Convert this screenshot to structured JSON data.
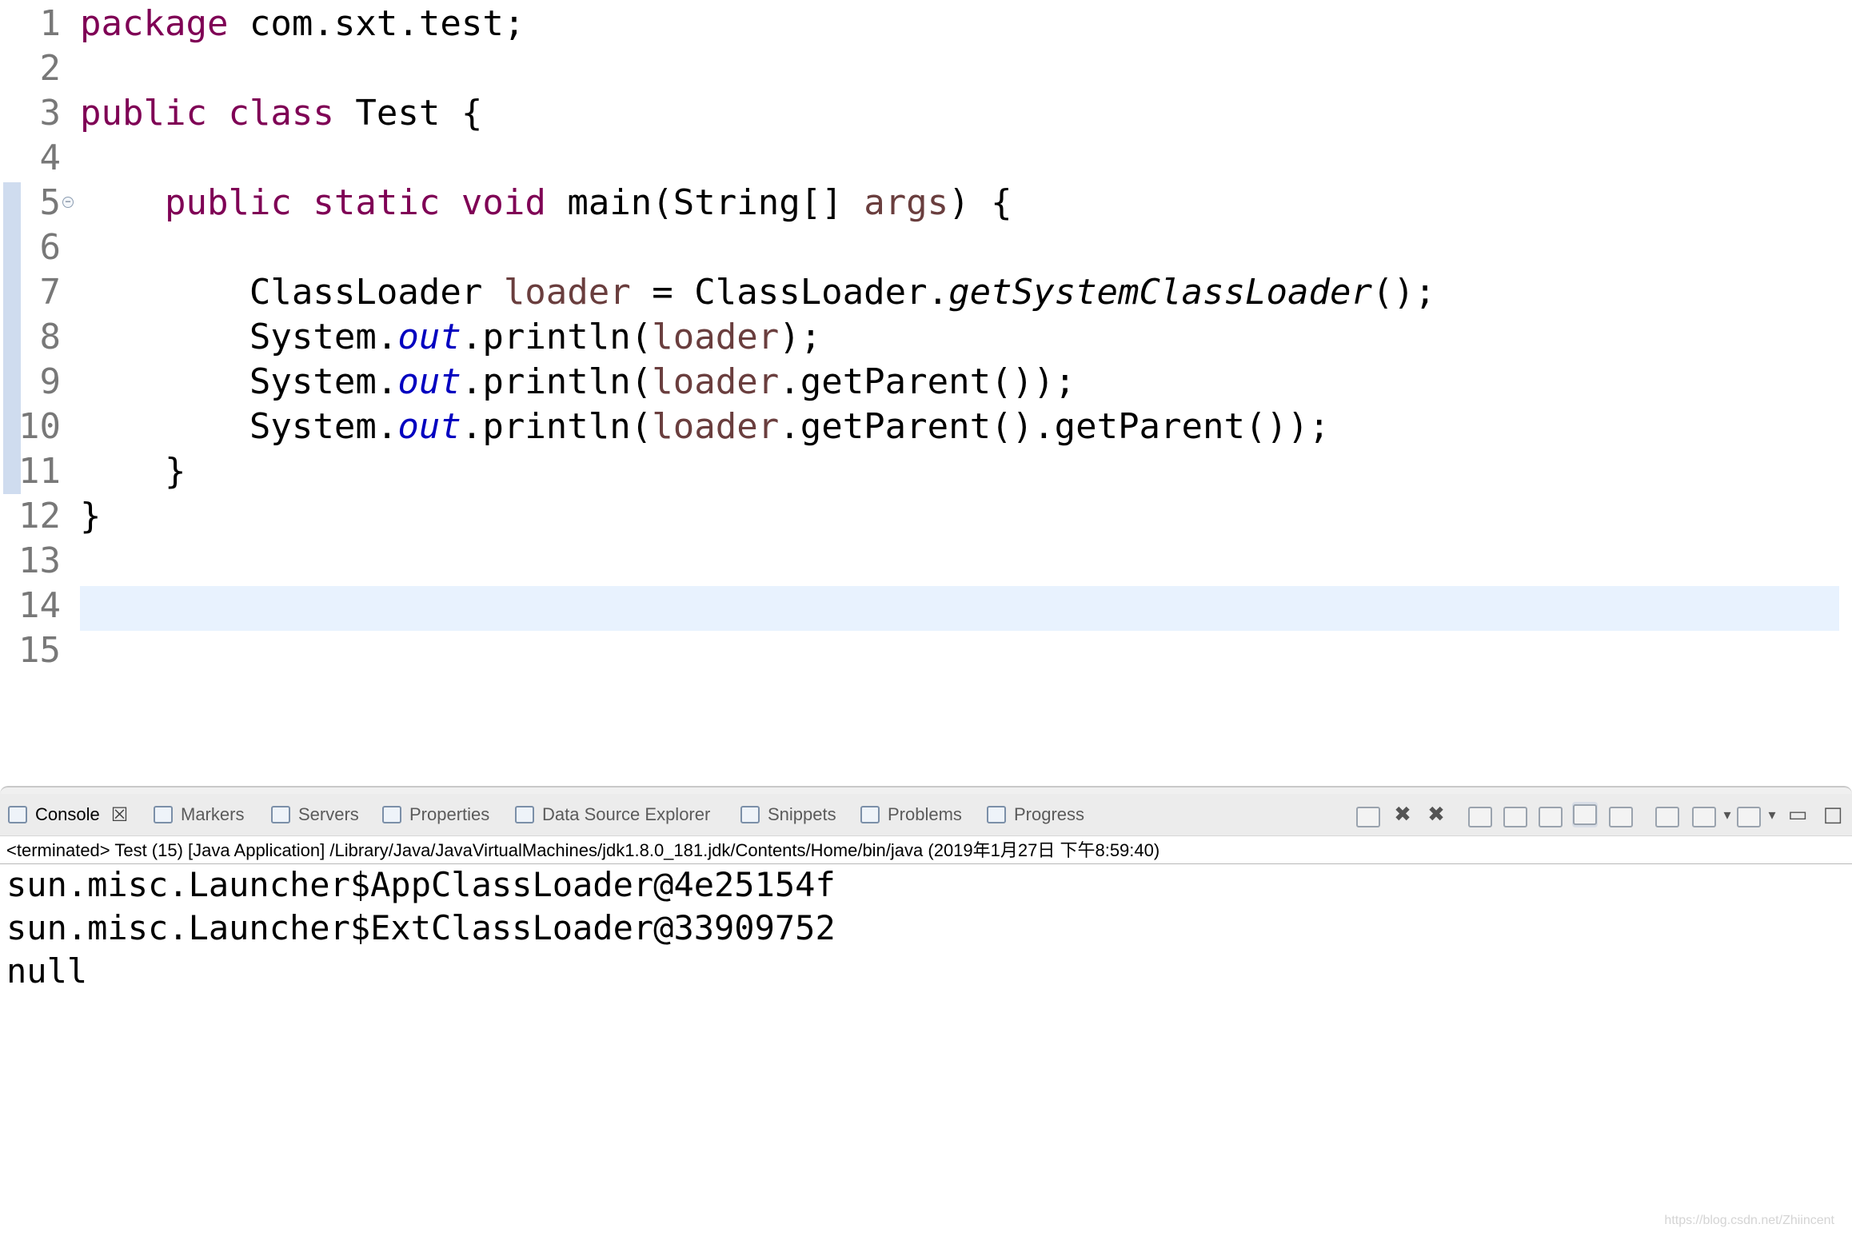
{
  "editor": {
    "lines": [
      {
        "num": "1",
        "parts": [
          {
            "t": "package",
            "c": "kw"
          },
          {
            "t": " com.sxt.test;"
          }
        ]
      },
      {
        "num": "2",
        "parts": []
      },
      {
        "num": "3",
        "parts": [
          {
            "t": "public",
            "c": "kw"
          },
          {
            "t": " "
          },
          {
            "t": "class",
            "c": "kw"
          },
          {
            "t": " Test {"
          }
        ]
      },
      {
        "num": "4",
        "parts": []
      },
      {
        "num": "5",
        "fold": true,
        "parts": [
          {
            "t": "    "
          },
          {
            "t": "public",
            "c": "kw"
          },
          {
            "t": " "
          },
          {
            "t": "static",
            "c": "kw"
          },
          {
            "t": " "
          },
          {
            "t": "void",
            "c": "kw"
          },
          {
            "t": " main(String[] "
          },
          {
            "t": "args",
            "c": "var"
          },
          {
            "t": ") {"
          }
        ]
      },
      {
        "num": "6",
        "parts": []
      },
      {
        "num": "7",
        "parts": [
          {
            "t": "        ClassLoader "
          },
          {
            "t": "loader",
            "c": "var"
          },
          {
            "t": " = ClassLoader."
          },
          {
            "t": "getSystemClassLoader",
            "c": "smeth"
          },
          {
            "t": "();"
          }
        ]
      },
      {
        "num": "8",
        "parts": [
          {
            "t": "        System."
          },
          {
            "t": "out",
            "c": "fld"
          },
          {
            "t": ".println("
          },
          {
            "t": "loader",
            "c": "var"
          },
          {
            "t": ");"
          }
        ]
      },
      {
        "num": "9",
        "parts": [
          {
            "t": "        System."
          },
          {
            "t": "out",
            "c": "fld"
          },
          {
            "t": ".println("
          },
          {
            "t": "loader",
            "c": "var"
          },
          {
            "t": ".getParent());"
          }
        ]
      },
      {
        "num": "10",
        "parts": [
          {
            "t": "        System."
          },
          {
            "t": "out",
            "c": "fld"
          },
          {
            "t": ".println("
          },
          {
            "t": "loader",
            "c": "var"
          },
          {
            "t": ".getParent().getParent());"
          }
        ]
      },
      {
        "num": "11",
        "parts": [
          {
            "t": "    }"
          }
        ]
      },
      {
        "num": "12",
        "parts": [
          {
            "t": "}"
          }
        ]
      },
      {
        "num": "13",
        "parts": []
      },
      {
        "num": "14",
        "parts": []
      },
      {
        "num": "15",
        "parts": []
      }
    ],
    "fold_glyph": "⊖"
  },
  "tabs": [
    {
      "id": "console",
      "label": "Console",
      "active": true,
      "icon": "console-icon"
    },
    {
      "id": "markers",
      "label": "Markers",
      "icon": "markers-icon"
    },
    {
      "id": "servers",
      "label": "Servers",
      "icon": "servers-icon"
    },
    {
      "id": "properties",
      "label": "Properties",
      "icon": "properties-icon"
    },
    {
      "id": "data-source-explorer",
      "label": "Data Source Explorer",
      "icon": "data-source-explorer-icon"
    },
    {
      "id": "snippets",
      "label": "Snippets",
      "icon": "snippets-icon"
    },
    {
      "id": "problems",
      "label": "Problems",
      "icon": "problems-icon"
    },
    {
      "id": "progress",
      "label": "Progress",
      "icon": "progress-icon"
    }
  ],
  "tab_close_glyph": "☒",
  "toolbar_glyphs": {
    "remove_launch": "✖",
    "remove_all": "✖",
    "minimize": "▭",
    "maximize": "□",
    "dropdown": "▾"
  },
  "console": {
    "header": "<terminated> Test (15) [Java Application] /Library/Java/JavaVirtualMachines/jdk1.8.0_181.jdk/Contents/Home/bin/java (2019年1月27日 下午8:59:40)",
    "output": [
      "sun.misc.Launcher$AppClassLoader@4e25154f",
      "sun.misc.Launcher$ExtClassLoader@33909752",
      "null"
    ]
  },
  "watermark": "https://blog.csdn.net/Zhiincent",
  "colors": {
    "keyword": "#7f0055",
    "local_variable": "#6a3e3e",
    "static_field": "#0000c0",
    "line_number": "#787878",
    "current_line": "#e8f2fe",
    "change_bar": "#cfdcef"
  }
}
